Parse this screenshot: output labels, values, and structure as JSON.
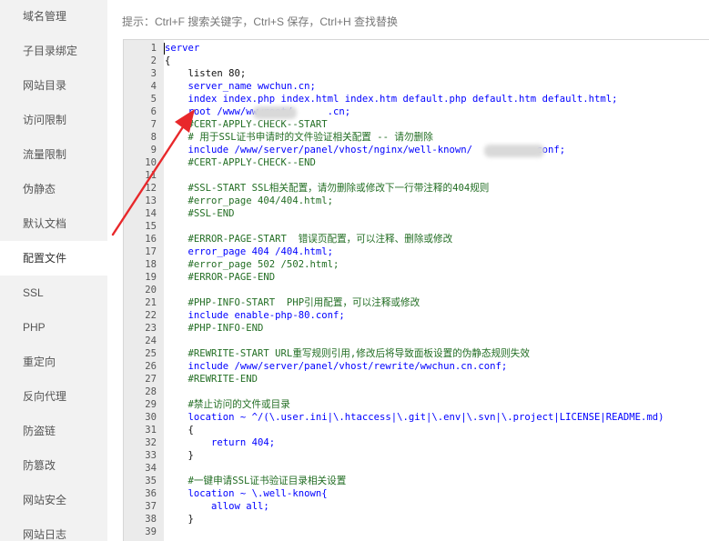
{
  "sidebar": {
    "items": [
      {
        "label": "域名管理"
      },
      {
        "label": "子目录绑定"
      },
      {
        "label": "网站目录"
      },
      {
        "label": "访问限制"
      },
      {
        "label": "流量限制"
      },
      {
        "label": "伪静态"
      },
      {
        "label": "默认文档"
      },
      {
        "label": "配置文件",
        "active": true
      },
      {
        "label": "SSL"
      },
      {
        "label": "PHP"
      },
      {
        "label": "重定向"
      },
      {
        "label": "反向代理"
      },
      {
        "label": "防盗链"
      },
      {
        "label": "防篡改"
      },
      {
        "label": "网站安全"
      },
      {
        "label": "网站日志"
      }
    ]
  },
  "tip": "提示：Ctrl+F 搜索关键字，Ctrl+S 保存，Ctrl+H 查找替换",
  "editor": {
    "lines": [
      {
        "num": "1",
        "text": "server"
      },
      {
        "num": "2",
        "text": "{"
      },
      {
        "num": "3",
        "text": "    listen 80;"
      },
      {
        "num": "4",
        "text": "    server_name wwchun.cn;"
      },
      {
        "num": "5",
        "text": "    index index.php index.html index.htm default.php default.htm default.html;"
      },
      {
        "num": "6",
        "text": "    root /www/wwwroot/      .cn;"
      },
      {
        "num": "7",
        "text": "    #CERT-APPLY-CHECK--START"
      },
      {
        "num": "8",
        "text": "    # 用于SSL证书申请时的文件验证相关配置 -- 请勿删除"
      },
      {
        "num": "9",
        "text": "    include /www/server/panel/vhost/nginx/well-known/          .conf;"
      },
      {
        "num": "10",
        "text": "    #CERT-APPLY-CHECK--END"
      },
      {
        "num": "11",
        "text": ""
      },
      {
        "num": "12",
        "text": "    #SSL-START SSL相关配置，请勿删除或修改下一行带注释的404规则"
      },
      {
        "num": "13",
        "text": "    #error_page 404/404.html;"
      },
      {
        "num": "14",
        "text": "    #SSL-END"
      },
      {
        "num": "15",
        "text": ""
      },
      {
        "num": "16",
        "text": "    #ERROR-PAGE-START  错误页配置，可以注释、删除或修改"
      },
      {
        "num": "17",
        "text": "    error_page 404 /404.html;"
      },
      {
        "num": "18",
        "text": "    #error_page 502 /502.html;"
      },
      {
        "num": "19",
        "text": "    #ERROR-PAGE-END"
      },
      {
        "num": "20",
        "text": ""
      },
      {
        "num": "21",
        "text": "    #PHP-INFO-START  PHP引用配置，可以注释或修改"
      },
      {
        "num": "22",
        "text": "    include enable-php-80.conf;"
      },
      {
        "num": "23",
        "text": "    #PHP-INFO-END"
      },
      {
        "num": "24",
        "text": ""
      },
      {
        "num": "25",
        "text": "    #REWRITE-START URL重写规则引用,修改后将导致面板设置的伪静态规则失效"
      },
      {
        "num": "26",
        "text": "    include /www/server/panel/vhost/rewrite/wwchun.cn.conf;"
      },
      {
        "num": "27",
        "text": "    #REWRITE-END"
      },
      {
        "num": "28",
        "text": ""
      },
      {
        "num": "29",
        "text": "    #禁止访问的文件或目录"
      },
      {
        "num": "30",
        "text": "    location ~ ^/(\\.user.ini|\\.htaccess|\\.git|\\.env|\\.svn|\\.project|LICENSE|README.md)"
      },
      {
        "num": "31",
        "text": "    {"
      },
      {
        "num": "32",
        "text": "        return 404;"
      },
      {
        "num": "33",
        "text": "    }"
      },
      {
        "num": "34",
        "text": ""
      },
      {
        "num": "35",
        "text": "    #一键申请SSL证书验证目录相关设置"
      },
      {
        "num": "36",
        "text": "    location ~ \\.well-known{"
      },
      {
        "num": "37",
        "text": "        allow all;"
      },
      {
        "num": "38",
        "text": "    }"
      },
      {
        "num": "39",
        "text": ""
      }
    ]
  },
  "colors": {
    "keyword": "#0000ff",
    "comment": "#236e24",
    "directive": "#003369",
    "arrow": "#e8282b"
  }
}
